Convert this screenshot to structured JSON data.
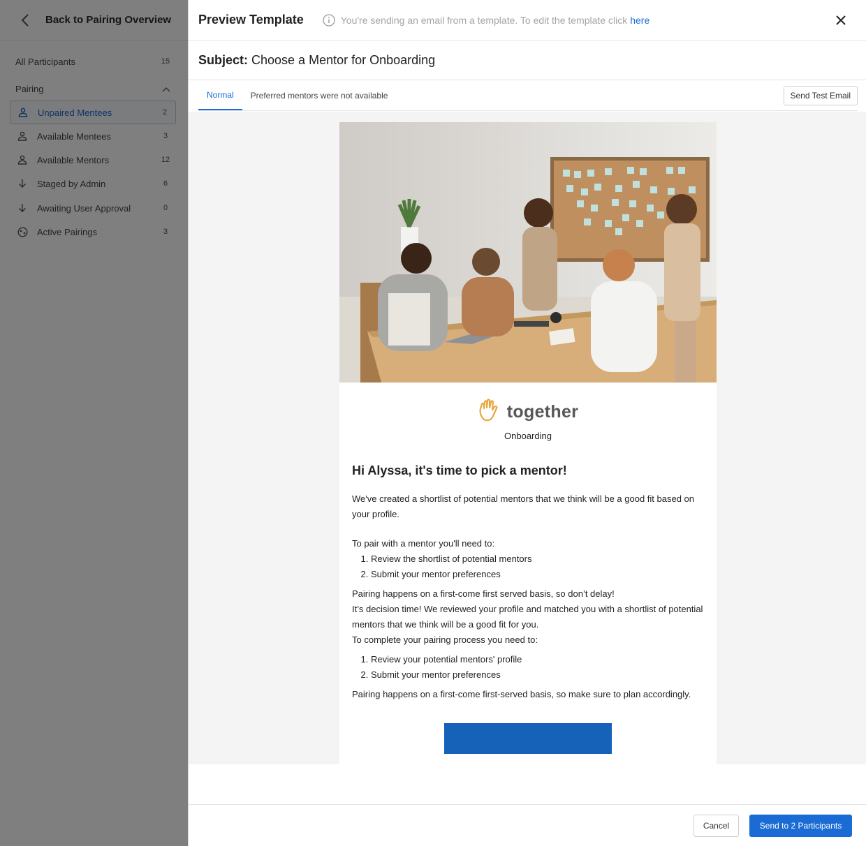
{
  "sidebar": {
    "back_label": "Back to Pairing Overview",
    "all_participants": {
      "label": "All Participants",
      "count": "15"
    },
    "section_label": "Pairing",
    "items": [
      {
        "label": "Unpaired Mentees",
        "count": "2",
        "icon": "person-icon",
        "active": true
      },
      {
        "label": "Available Mentees",
        "count": "3",
        "icon": "person-icon"
      },
      {
        "label": "Available Mentors",
        "count": "12",
        "icon": "person-icon"
      },
      {
        "label": "Staged by Admin",
        "count": "6",
        "icon": "arrow-down-icon"
      },
      {
        "label": "Awaiting User Approval",
        "count": "0",
        "icon": "arrow-down-icon"
      },
      {
        "label": "Active Pairings",
        "count": "3",
        "icon": "handshake-icon"
      }
    ]
  },
  "dialog": {
    "title": "Preview Template",
    "info_text": "You're sending an email from a template. To edit the template click",
    "info_link": "here",
    "subject_label": "Subject:",
    "subject_value": "Choose a Mentor for Onboarding",
    "tabs": [
      "Normal",
      "Preferred mentors were not available"
    ],
    "send_test_label": "Send Test Email",
    "cancel_label": "Cancel",
    "send_label": "Send to 2 Participants"
  },
  "email": {
    "brand_name": "together",
    "brand_sub": "Onboarding",
    "greeting": "Hi Alyssa, it's time to pick a mentor!",
    "intro": "We've created a shortlist of potential mentors that we think will be a good fit based on your profile.",
    "steps_intro": "To pair with a mentor you'll need to:",
    "steps": [
      "Review the shortlist of potential mentors",
      "Submit your mentor preferences"
    ],
    "note1": "Pairing happens on a first-come first served basis, so don’t delay!",
    "para2": "It’s decision time! We reviewed your profile and matched you with a shortlist of potential mentors that we think will be a good fit for you.",
    "steps2_intro": "To complete your pairing process you need to:",
    "steps2": [
      "Review your potential mentors' profile",
      "Submit your mentor preferences"
    ],
    "note2": "Pairing happens on a first-come first-served basis, so make sure to plan accordingly."
  },
  "colors": {
    "accent": "#1a6cd4",
    "cta": "#1662b8",
    "brand_orange": "#e8a640"
  }
}
